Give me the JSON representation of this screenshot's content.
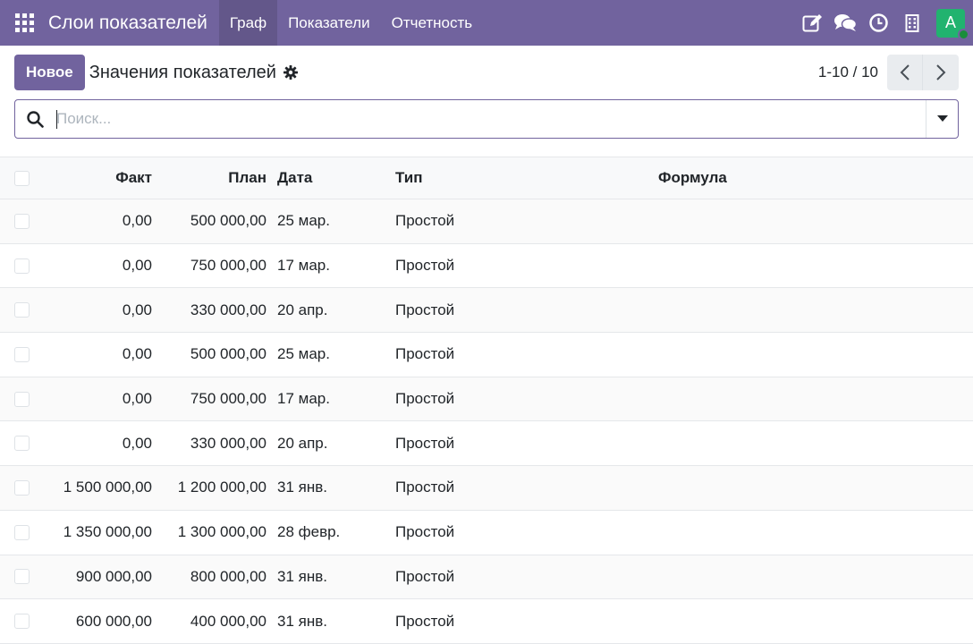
{
  "navbar": {
    "app_name": "Слои показателей",
    "menu": [
      {
        "label": "Граф",
        "active": true
      },
      {
        "label": "Показатели",
        "active": false
      },
      {
        "label": "Отчетность",
        "active": false
      }
    ],
    "avatar_letter": "A",
    "colors": {
      "navbar_bg": "#71639e",
      "avatar_bg": "#21b36f",
      "status_dot": "#1a8d3b"
    },
    "icons": [
      "apps-grid-icon",
      "edit-icon",
      "chat-icon",
      "clock-icon",
      "building-icon"
    ]
  },
  "control_panel": {
    "new_button": "Новое",
    "breadcrumb": "Значения показателей",
    "pager_value": "1-10 / 10"
  },
  "search": {
    "placeholder": "Поиск...",
    "value": ""
  },
  "table": {
    "headers": {
      "fact": "Факт",
      "plan": "План",
      "date": "Дата",
      "type": "Тип",
      "formula": "Формула"
    },
    "rows": [
      {
        "fact": "0,00",
        "plan": "500 000,00",
        "date": "25 мар.",
        "type": "Простой",
        "formula": ""
      },
      {
        "fact": "0,00",
        "plan": "750 000,00",
        "date": "17 мар.",
        "type": "Простой",
        "formula": ""
      },
      {
        "fact": "0,00",
        "plan": "330 000,00",
        "date": "20 апр.",
        "type": "Простой",
        "formula": ""
      },
      {
        "fact": "0,00",
        "plan": "500 000,00",
        "date": "25 мар.",
        "type": "Простой",
        "formula": ""
      },
      {
        "fact": "0,00",
        "plan": "750 000,00",
        "date": "17 мар.",
        "type": "Простой",
        "formula": ""
      },
      {
        "fact": "0,00",
        "plan": "330 000,00",
        "date": "20 апр.",
        "type": "Простой",
        "formula": ""
      },
      {
        "fact": "1 500 000,00",
        "plan": "1 200 000,00",
        "date": "31 янв.",
        "type": "Простой",
        "formula": ""
      },
      {
        "fact": "1 350 000,00",
        "plan": "1 300 000,00",
        "date": "28 февр.",
        "type": "Простой",
        "formula": ""
      },
      {
        "fact": "900 000,00",
        "plan": "800 000,00",
        "date": "31 янв.",
        "type": "Простой",
        "formula": ""
      },
      {
        "fact": "600 000,00",
        "plan": "400 000,00",
        "date": "31 янв.",
        "type": "Простой",
        "formula": ""
      }
    ]
  }
}
